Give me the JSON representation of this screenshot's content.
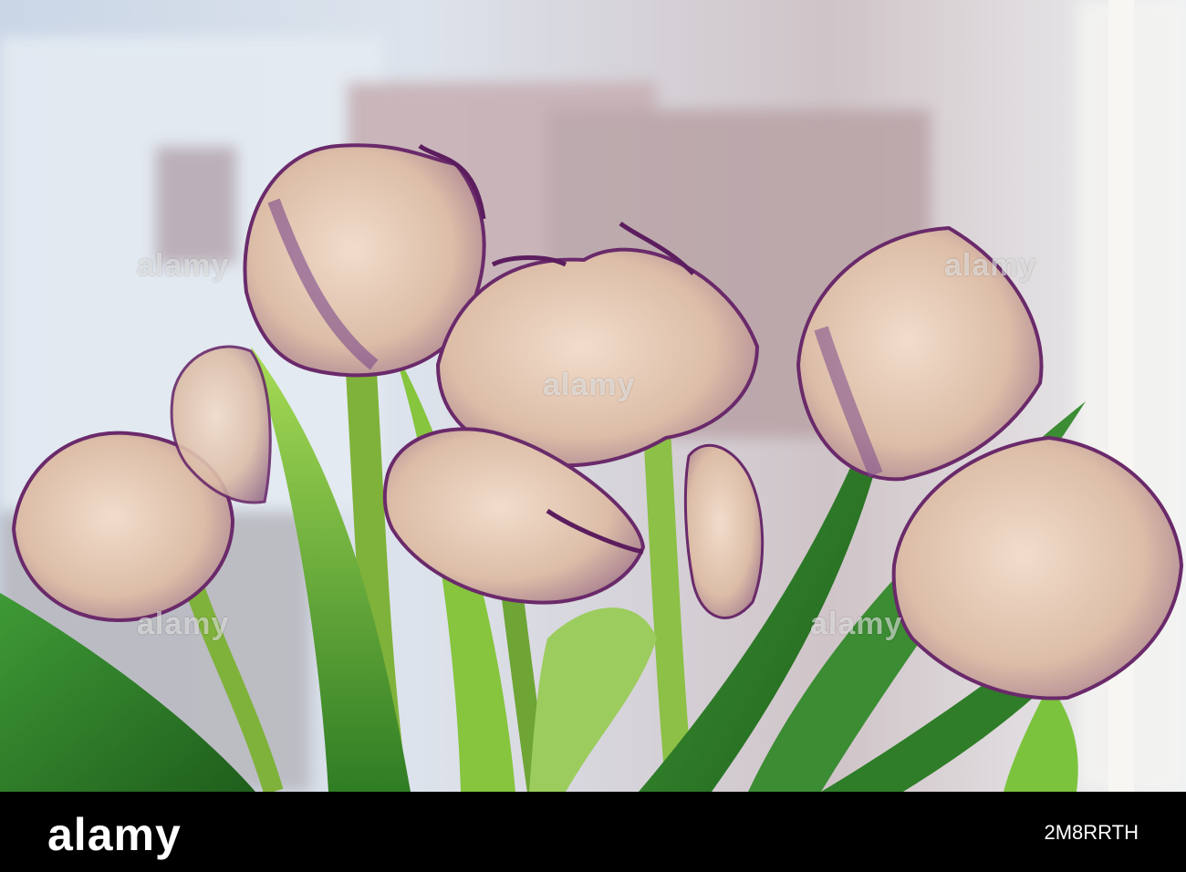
{
  "photo": {
    "description_icon": "tulips-photo",
    "colors": {
      "window_bg": "#d9e1ec",
      "leaf": "#2f8a2c",
      "leaf_light": "#9fd64a",
      "petal": "#e7cdb9",
      "petal_edge": "#6a2a6a"
    }
  },
  "watermark": {
    "text": "alamy"
  },
  "footer": {
    "logo": "alamy",
    "image_id": "2M8RRTH"
  }
}
